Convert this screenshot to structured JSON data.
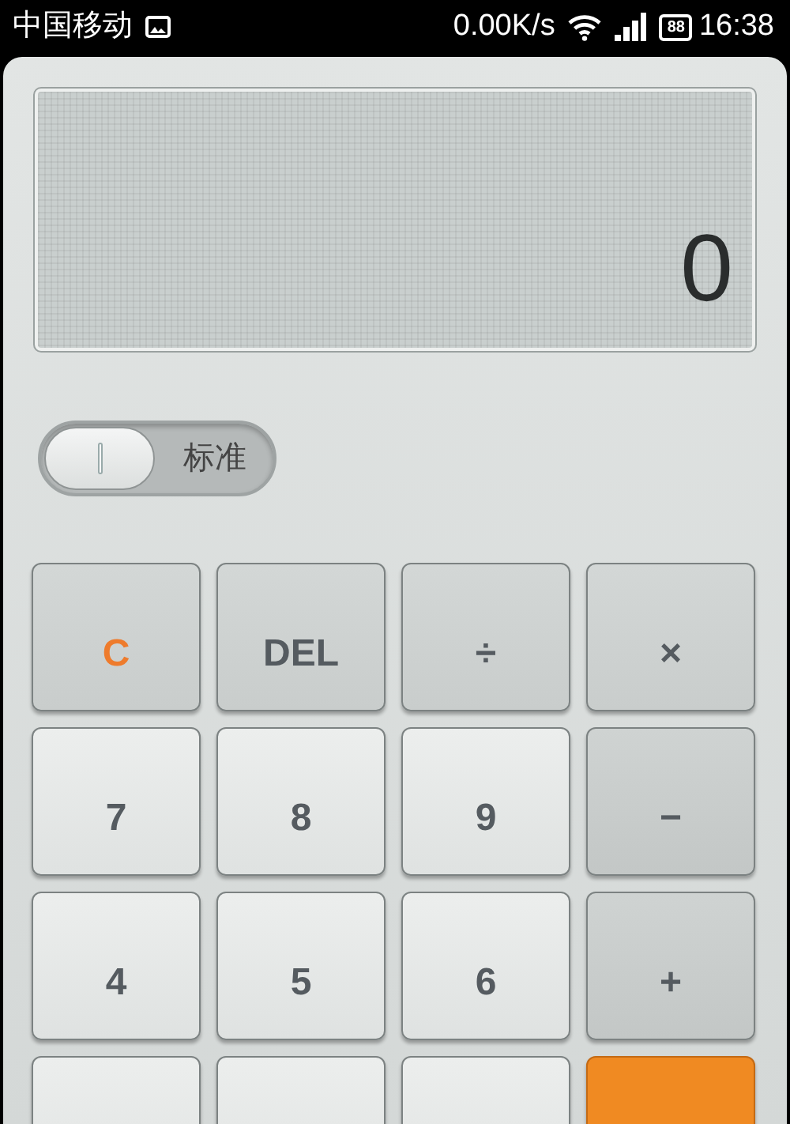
{
  "status_bar": {
    "carrier": "中国移动",
    "speed": "0.00K/s",
    "battery": "88",
    "time": "16:38"
  },
  "display": {
    "value": "0"
  },
  "mode_toggle": {
    "label": "标准",
    "on": false
  },
  "keys": [
    {
      "label": "C",
      "kind": "clear"
    },
    {
      "label": "DEL",
      "kind": "function"
    },
    {
      "label": "÷",
      "kind": "function"
    },
    {
      "label": "×",
      "kind": "function"
    },
    {
      "label": "7",
      "kind": "digit"
    },
    {
      "label": "8",
      "kind": "digit"
    },
    {
      "label": "9",
      "kind": "digit"
    },
    {
      "label": "−",
      "kind": "operator"
    },
    {
      "label": "4",
      "kind": "digit"
    },
    {
      "label": "5",
      "kind": "digit"
    },
    {
      "label": "6",
      "kind": "digit"
    },
    {
      "label": "+",
      "kind": "operator"
    },
    {
      "kind": "digit"
    },
    {
      "kind": "digit"
    },
    {
      "kind": "digit"
    },
    {
      "kind": "equals"
    }
  ]
}
